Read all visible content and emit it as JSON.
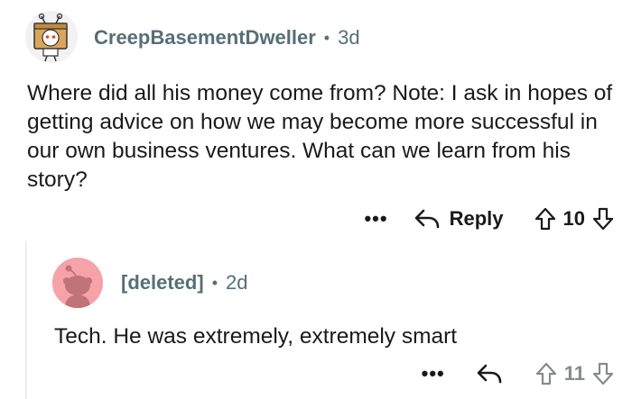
{
  "comments": [
    {
      "username": "CreepBasementDweller",
      "separator": "•",
      "age": "3d",
      "body": "Where did all his money come from? Note: I ask in hopes of getting advice on how we may become more successful in our own business ventures. What can we learn from his story?",
      "more_label": "•••",
      "reply_label": "Reply",
      "score": "10",
      "avatar_icon": "robot-box-avatar-icon"
    },
    {
      "username": "[deleted]",
      "separator": "•",
      "age": "2d",
      "body": "Tech. He was extremely, extremely smart",
      "more_label": "•••",
      "score": "11",
      "avatar_icon": "snoo-avatar-icon"
    }
  ],
  "colors": {
    "meta_text": "#576f76",
    "body_text": "#1a1a1b",
    "deleted_avatar_bg": "#f5a3a8",
    "thread_line": "#edeff1"
  }
}
